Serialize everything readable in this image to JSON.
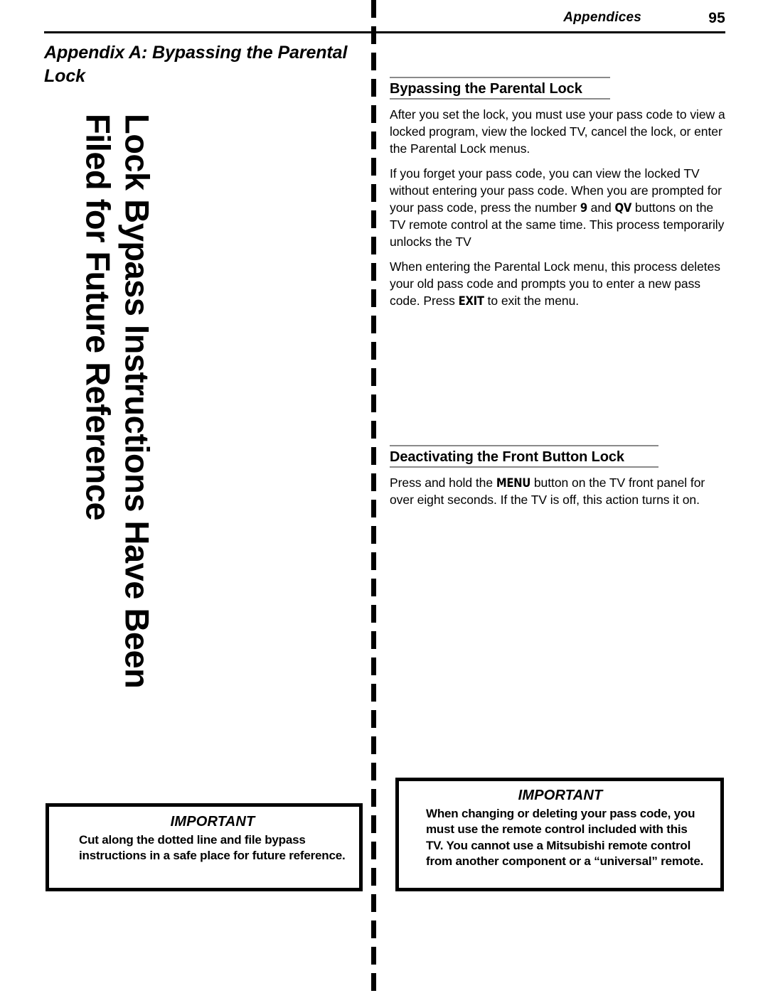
{
  "header": {
    "section_label": "Appendices",
    "page_number": "95"
  },
  "appendix_title": "Appendix A:  Bypassing the Parental Lock",
  "rotated_banner": "Lock Bypass Instructions Have Been Filed for Future Reference",
  "sections": [
    {
      "heading": "Bypassing the Parental Lock",
      "paragraphs": [
        {
          "parts": [
            {
              "text": "After you set the lock, you must use your pass code to view a locked program, view the locked TV, cancel the lock, or enter the Parental Lock menus.",
              "style": "normal"
            }
          ]
        },
        {
          "parts": [
            {
              "text": "If you forget your pass code, you can view the locked TV without entering your pass code.  When you are prompted for your pass code, press the number ",
              "style": "normal"
            },
            {
              "text": "9",
              "style": "button"
            },
            {
              "text": " and ",
              "style": "normal"
            },
            {
              "text": "QV",
              "style": "button"
            },
            {
              "text": " buttons on the TV remote control at the same time.  This process temporarily unlocks the TV",
              "style": "normal"
            }
          ]
        },
        {
          "parts": [
            {
              "text": "When entering the Parental Lock menu, this process deletes your old pass code and prompts you to enter a new pass code.  Press ",
              "style": "normal"
            },
            {
              "text": "EXIT",
              "style": "button"
            },
            {
              "text": " to exit the menu.",
              "style": "normal"
            }
          ]
        }
      ]
    },
    {
      "heading": "Deactivating the Front Button Lock",
      "paragraphs": [
        {
          "parts": [
            {
              "text": "Press and hold the ",
              "style": "normal"
            },
            {
              "text": "MENU",
              "style": "button"
            },
            {
              "text": " button on the TV front panel for over eight seconds.  If the TV is off, this action turns it on.",
              "style": "normal"
            }
          ]
        }
      ]
    }
  ],
  "important_boxes": {
    "left": {
      "title": "IMPORTANT",
      "body": "Cut along the dotted line and file bypass instructions in a safe place for future reference."
    },
    "right": {
      "title": "IMPORTANT",
      "body": "When changing or deleting your pass code, you must use the remote control included with this TV.  You cannot use a Mitsubishi remote control from another component or a “universal” remote."
    }
  },
  "colors": {
    "ink": "#000000",
    "rule_gray": "#8a8a8a",
    "paper": "#ffffff"
  }
}
